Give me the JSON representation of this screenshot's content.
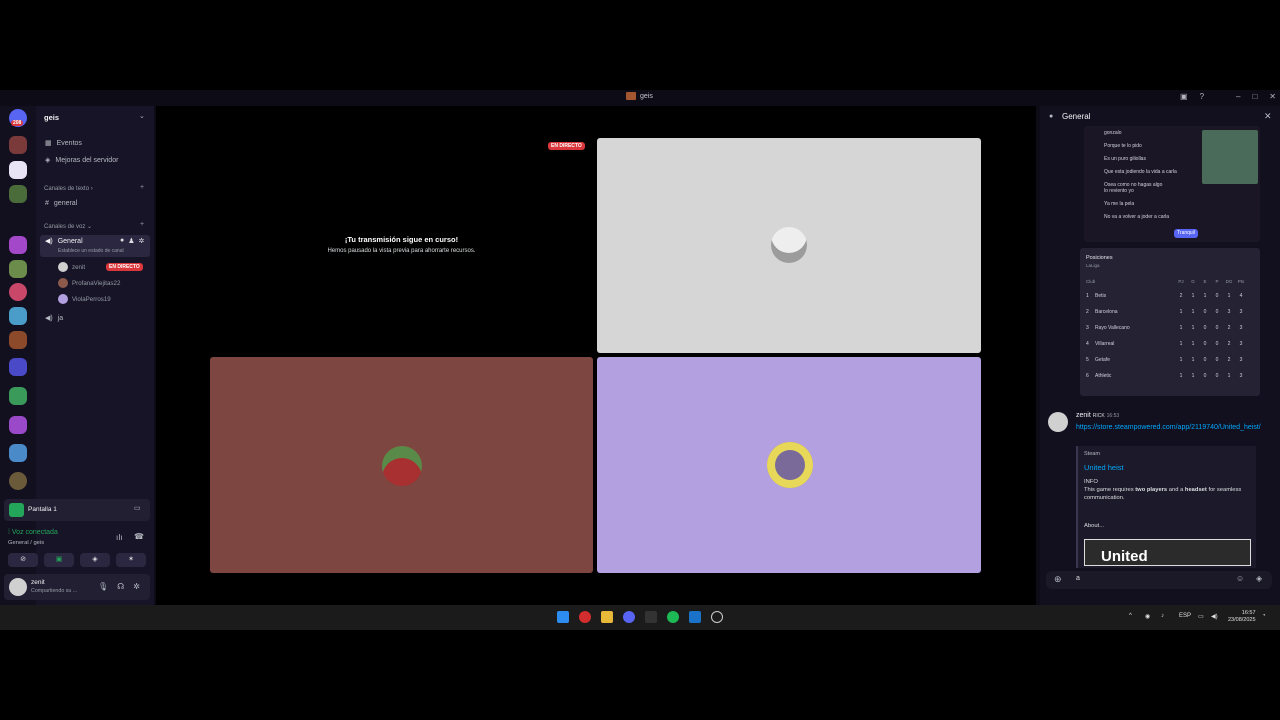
{
  "window": {
    "title": "geis"
  },
  "server": {
    "name": "geis",
    "badge": "208"
  },
  "sidebar": {
    "events": "Eventos",
    "boosts": "Mejoras del servidor",
    "text_category": "Canales de texto",
    "text_channel": "general",
    "voice_category": "Canales de voz",
    "voice_channel": "General",
    "voice_status": "Establece un estado de canal",
    "voice_users": [
      {
        "name": "zenit",
        "live": "EN DIRECTO"
      },
      {
        "name": "ProfanaViejitas22"
      },
      {
        "name": "ViolaPerros19"
      }
    ],
    "voice_channel_2": "ja"
  },
  "stream_panel": {
    "label": "Pantalla 1"
  },
  "voice": {
    "status": "Voz conectada",
    "location": "General / geis"
  },
  "user": {
    "name": "zenit",
    "status": "Compartiendo su ..."
  },
  "stage": {
    "live_badge": "EN DIRECTO",
    "paused_title": "¡Tu transmisión sigue en curso!",
    "paused_sub": "Hemos pausado la vista previa para ahorrarte recursos.",
    "tile_colors": {
      "tile1": "#d6d6d6",
      "tile2": "#7d4640",
      "tile3": "#b3a0e0"
    }
  },
  "chat": {
    "title": "General",
    "bubbles": [
      "gonzalo",
      "Porque te lo pido",
      "Es un puro giliollas",
      "Que esta jodiendo la vida a carla",
      "Osea como no hagas algo lo reviento yo",
      "Ya me la pela",
      "No va a volver a joder a carla"
    ],
    "bubble_button": "Tranquil",
    "standings": {
      "title": "Posiciones",
      "sub": "LaLiga",
      "col_club": "Club",
      "cols": [
        "PJ",
        "G",
        "E",
        "P",
        "DG",
        "Pts"
      ],
      "rows": [
        {
          "pos": "1",
          "team": "Betis",
          "vals": [
            "2",
            "1",
            "1",
            "0",
            "1",
            "4"
          ]
        },
        {
          "pos": "2",
          "team": "Barcelona",
          "vals": [
            "1",
            "1",
            "0",
            "0",
            "3",
            "3"
          ]
        },
        {
          "pos": "3",
          "team": "Rayo Vallecano",
          "vals": [
            "1",
            "1",
            "0",
            "0",
            "2",
            "3"
          ]
        },
        {
          "pos": "4",
          "team": "Villarreal",
          "vals": [
            "1",
            "1",
            "0",
            "0",
            "2",
            "3"
          ]
        },
        {
          "pos": "5",
          "team": "Getafe",
          "vals": [
            "1",
            "1",
            "0",
            "0",
            "2",
            "3"
          ]
        },
        {
          "pos": "6",
          "team": "Athletic",
          "vals": [
            "1",
            "1",
            "0",
            "0",
            "1",
            "3"
          ]
        }
      ]
    },
    "message": {
      "author": "zenit",
      "tag": "RICK",
      "time": "16:53",
      "link": "https://store.steampowered.com/app/2119740/United_heist/",
      "embed_provider": "Steam",
      "embed_title": "United heist",
      "embed_info": "INFO",
      "embed_desc_1": "This game requires",
      "embed_desc_bold_1": "two players",
      "embed_desc_2": "and a",
      "embed_desc_bold_2": "headset",
      "embed_desc_3": "for seamless communication.",
      "embed_about": "About...",
      "embed_image_text": "United"
    },
    "input_value": "a"
  },
  "taskbar": {
    "lang": "ESP",
    "time": "16:57",
    "date": "23/08/2025"
  }
}
